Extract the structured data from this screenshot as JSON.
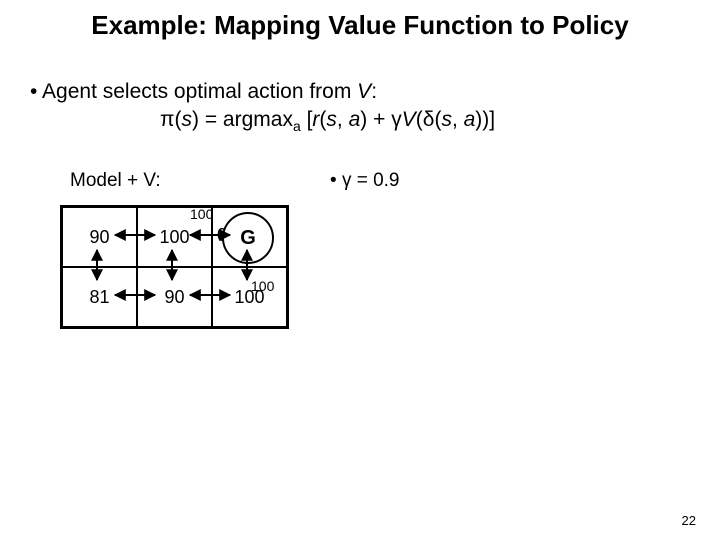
{
  "title": "Example: Mapping Value Function to Policy",
  "bullet": "• Agent selects optimal action from ",
  "bullet_V": "V",
  "bullet_colon": ":",
  "formula": {
    "pi": "π",
    "open": "(",
    "s": "s",
    "close_eq": ") = argmax",
    "sub_a": "a",
    "mid1": " [",
    "r": "r",
    "paren2": "(",
    "s2": "s",
    "comma": ", ",
    "a2": "a",
    "close2": ")",
    "plus": " + ",
    "gamma": "γ",
    "V": "V",
    "open3": "(",
    "delta": "δ",
    "open4": "(",
    "s3": "s",
    "comma2": ", ",
    "a3": "a",
    "close4": ")",
    "close3": ")]"
  },
  "modelv_label": "Model + V:",
  "gamma_note_prefix": "• ",
  "gamma_sym": "γ",
  "gamma_note_suffix": " = 0.9",
  "gamma_value": 0.9,
  "grid": {
    "c00": "90",
    "c01": "100",
    "c02_goal": "G",
    "c02_zero": "0",
    "c10": "81",
    "c11": "90",
    "c12": "100"
  },
  "rewards": {
    "to_goal_right": "100",
    "to_goal_up": "100"
  },
  "page_number": "22"
}
